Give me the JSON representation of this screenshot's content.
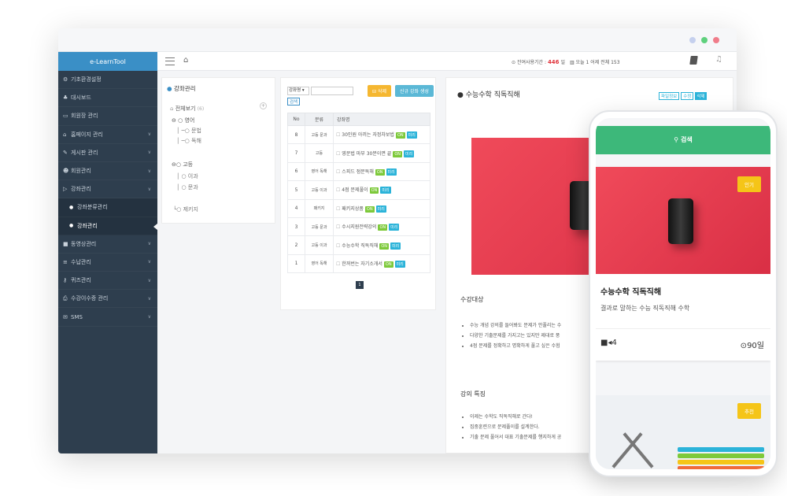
{
  "brand": "e-LearnTool",
  "colors": {
    "sidebar": "#2e3e4e",
    "brand": "#3a8fc6",
    "accent_green": "#3db87a",
    "badge_yellow": "#f5c518",
    "tag_on": "#7dc93a",
    "tag_preview": "#2bb3d9"
  },
  "sidebar": {
    "items": [
      {
        "label": "기초환경설정",
        "icon": "gear-icon",
        "chevron": false
      },
      {
        "label": "대시보드",
        "icon": "sitemap-icon",
        "chevron": false
      },
      {
        "label": "회원장 관리",
        "icon": "desktop-icon",
        "chevron": false
      },
      {
        "label": "홈페이지 관리",
        "icon": "home-icon",
        "chevron": true
      },
      {
        "label": "게시판 관리",
        "icon": "pencil-icon",
        "chevron": true
      },
      {
        "label": "회원관리",
        "icon": "users-icon",
        "chevron": true
      },
      {
        "label": "강좌관리",
        "icon": "folder-icon",
        "chevron": true
      },
      {
        "label": "강좌분류관리",
        "icon": "dot-icon",
        "chevron": false,
        "sub": true
      },
      {
        "label": "강좌관리",
        "icon": "dot-icon",
        "chevron": false,
        "sub": true,
        "active": true
      },
      {
        "label": "동영상관리",
        "icon": "video-icon",
        "chevron": true
      },
      {
        "label": "수납관리",
        "icon": "list-icon",
        "chevron": true
      },
      {
        "label": "퀴즈관리",
        "icon": "key-icon",
        "chevron": true
      },
      {
        "label": "수강이수증 관리",
        "icon": "print-icon",
        "chevron": true
      },
      {
        "label": "SMS",
        "icon": "envelope-icon",
        "chevron": true
      }
    ]
  },
  "topbar": {
    "status_prefix": "잔여사용기간 :",
    "days": "446",
    "days_unit": "일",
    "stats": "오늘 1  어제  전체 153"
  },
  "tree": {
    "title": "강좌관리",
    "all": "전체보기",
    "all_count": "(6)",
    "nodes": [
      "영어",
      "문법",
      "독해",
      "고등",
      "이과",
      "문과",
      "제키지"
    ]
  },
  "list": {
    "select_value": "강좌명",
    "search_button": "검색",
    "delete_button": "삭제",
    "new_button": "신규 강좌 생성",
    "headers": [
      "No",
      "분류",
      "강좌명"
    ],
    "rows": [
      {
        "no": "8",
        "cat": "고등 문과",
        "name": "30인원 아끼는 자정차보법",
        "tags": [
          "ON",
          "미리"
        ]
      },
      {
        "no": "7",
        "cat": "고등",
        "name": "영문법 마부 30분이면 끝",
        "tags": [
          "ON",
          "미리"
        ]
      },
      {
        "no": "6",
        "cat": "영어 독해",
        "name": "스피드 점문독해",
        "tags": [
          "ON",
          "미리"
        ]
      },
      {
        "no": "5",
        "cat": "고등 이과",
        "name": "4점 문제풀이",
        "tags": [
          "ON",
          "미리"
        ]
      },
      {
        "no": "4",
        "cat": "패키지",
        "name": "패키지상품",
        "tags": [
          "ON",
          "미리"
        ]
      },
      {
        "no": "3",
        "cat": "고등 문과",
        "name": "수시지원전략강의",
        "tags": [
          "ON",
          "미리"
        ]
      },
      {
        "no": "2",
        "cat": "고등 이과",
        "name": "수능수학 직독직해",
        "tags": [
          "ON",
          "미리"
        ]
      },
      {
        "no": "1",
        "cat": "영어 독해",
        "name": "한꺼번는 자기소개서",
        "tags": [
          "ON",
          "미리"
        ]
      }
    ],
    "page": "1"
  },
  "detail": {
    "title": "수능수학 직독직해",
    "buttons": [
      "파일정보",
      "수정",
      "삭제"
    ],
    "section1": "수강대상",
    "bullets1": [
      "수능 개념 강의를 들어봐도 문제가 안풀리는 수",
      "다양한 기출문제를 가지고는 있지만 제대로 풍",
      "4점 문제를 정확하고 명확하게 풀고 싶은 수험"
    ],
    "section2": "강의 특징",
    "bullets2": [
      "이제는 수학도 직독직해로 간다!",
      "집중훈련으로 문제풀이를 설계한다.",
      "기출 문제 풀어서 대표 기출문제를 행지하게 공"
    ]
  },
  "mobile": {
    "search_label": "검색",
    "card1_badge": "인기",
    "card1_title": "수능수학 직독직해",
    "card1_sub": "결과로 말하는 수능 직독직해 수학",
    "card1_videos": "4",
    "card1_days": "90일",
    "card2_badge": "추천"
  }
}
